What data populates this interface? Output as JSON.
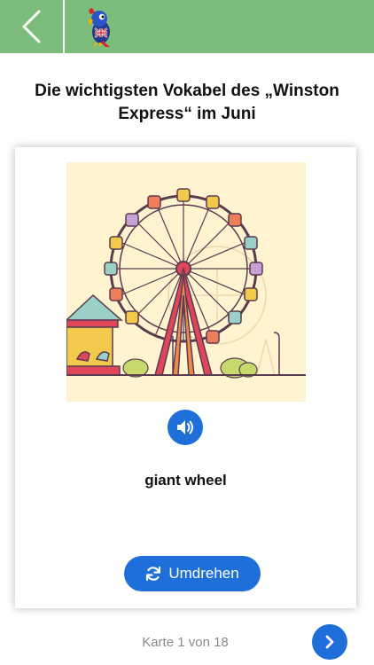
{
  "header": {
    "back_icon": "chevron-left-icon",
    "mascot_icon": "parrot-mascot-icon",
    "bar_color": "#7dbd7c"
  },
  "title": "Die wichtigsten Vokabel des „Winston Express“ im Juni",
  "card": {
    "image_icon": "ferris-wheel-illustration",
    "sound_icon": "speaker-icon",
    "word": "giant wheel",
    "flip_icon": "refresh-icon",
    "flip_label": "Umdrehen"
  },
  "footer": {
    "counter": "Karte 1 von 18",
    "next_icon": "chevron-right-icon"
  },
  "colors": {
    "accent": "#1e6fd9",
    "card_bg": "#ffffff",
    "image_bg": "#fff4cf"
  }
}
